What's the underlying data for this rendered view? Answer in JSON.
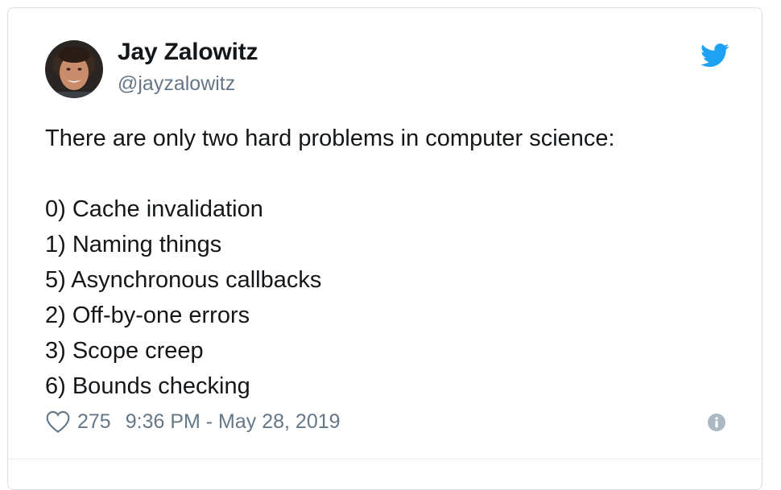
{
  "tweet": {
    "author_name": "Jay Zalowitz",
    "author_handle": "@jayzalowitz",
    "text_intro": "There are only two hard problems in computer science:",
    "list_items": [
      "0) Cache invalidation",
      "1) Naming things",
      "5) Asynchronous callbacks",
      "2) Off-by-one errors",
      "3) Scope creep",
      "6) Bounds checking"
    ],
    "like_count": "275",
    "timestamp": "9:36 PM - May 28, 2019"
  },
  "icons": {
    "brand": "twitter-bird-icon",
    "like": "heart-outline-icon",
    "info": "info-circle-icon"
  },
  "colors": {
    "brand_blue": "#1da1f2",
    "text_primary": "#14171a",
    "text_secondary": "#657786",
    "border": "#d8dee2",
    "info_icon": "#aab8c2"
  }
}
